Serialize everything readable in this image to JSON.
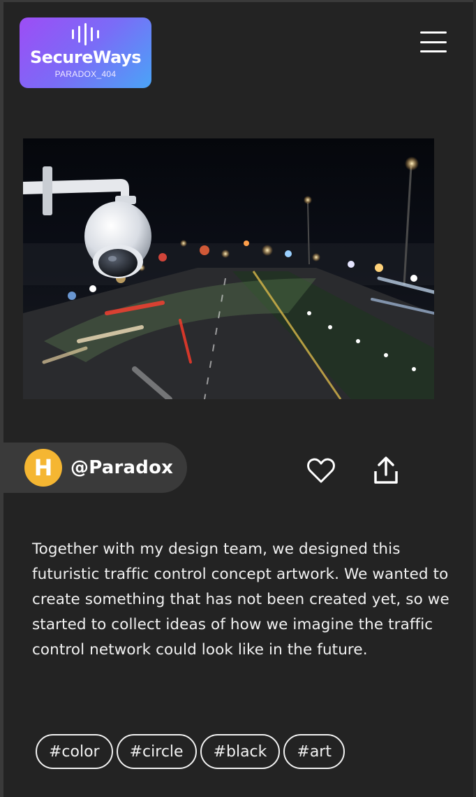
{
  "logo": {
    "title": "SecureWays",
    "subtitle": "PARADOX_404"
  },
  "menu": {
    "icon": "hamburger-menu-icon"
  },
  "hero": {
    "image": "security-camera-over-night-traffic"
  },
  "profile": {
    "avatar_letter": "H",
    "username": "@Paradox",
    "avatar_color": "#f5b632"
  },
  "actions": {
    "like_icon": "heart-outline-icon",
    "share_icon": "share-upload-icon"
  },
  "description": "Together with my design team, we designed this futuristic traffic control concept artwork. We wanted to create something that has not been created yet, so we started to collect ideas of how we imagine the traffic control network could look like in the future.",
  "tags": [
    "#color",
    "#circle",
    "#black",
    "#art"
  ],
  "colors": {
    "background": "#232323",
    "chip": "#3a3a3a",
    "logo_gradient_start": "#9d4df5",
    "logo_gradient_end": "#4aa4f7"
  }
}
